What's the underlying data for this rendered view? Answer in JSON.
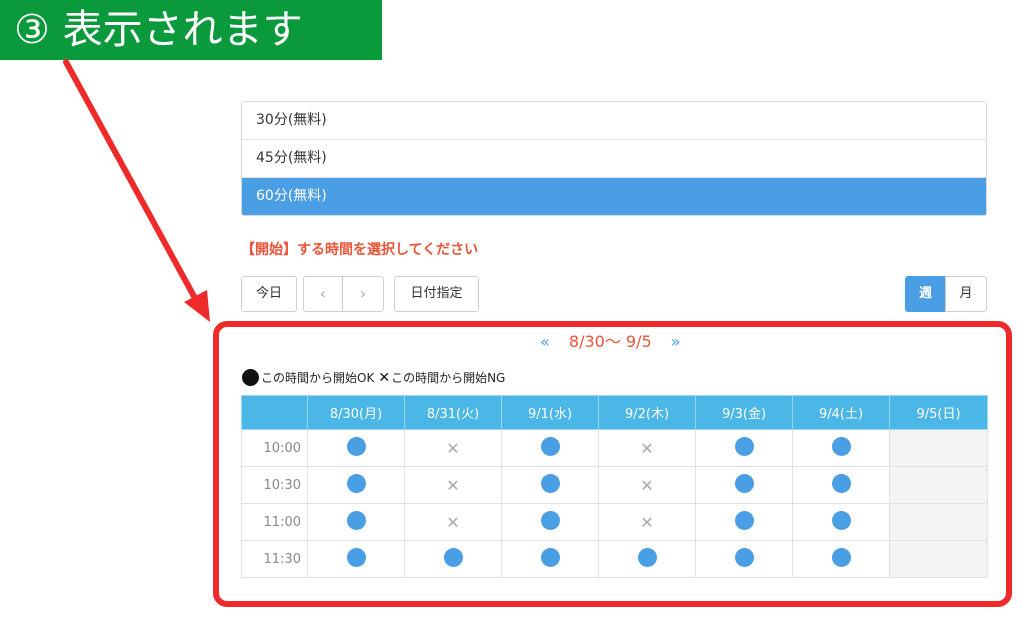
{
  "banner": {
    "text": "③ 表示されます",
    "color": "#0a9a3c"
  },
  "durations": [
    {
      "label": "30分(無料)",
      "selected": false
    },
    {
      "label": "45分(無料)",
      "selected": false
    },
    {
      "label": "60分(無料)",
      "selected": true
    }
  ],
  "instruction": "【開始】する時間を選択してください",
  "toolbar": {
    "today_label": "今日",
    "prev_icon": "chevron-left-icon",
    "next_icon": "chevron-right-icon",
    "date_label": "日付指定",
    "week_label": "週",
    "month_label": "月",
    "active_view": "週"
  },
  "range": {
    "prev_mark": "«",
    "text": "8/30〜 9/5",
    "next_mark": "»"
  },
  "legend": {
    "ok_text": "この時間から開始OK",
    "ng_text": "この時間から開始NG"
  },
  "schedule": {
    "columns": [
      "8/30(月)",
      "8/31(火)",
      "9/1(水)",
      "9/2(木)",
      "9/3(金)",
      "9/4(土)",
      "9/5(日)"
    ],
    "rows": [
      {
        "time": "10:00",
        "slots": [
          "ok",
          "ng",
          "ok",
          "ng",
          "ok",
          "ok",
          "closed"
        ]
      },
      {
        "time": "10:30",
        "slots": [
          "ok",
          "ng",
          "ok",
          "ng",
          "ok",
          "ok",
          "closed"
        ]
      },
      {
        "time": "11:00",
        "slots": [
          "ok",
          "ng",
          "ok",
          "ng",
          "ok",
          "ok",
          "closed"
        ]
      },
      {
        "time": "11:30",
        "slots": [
          "ok",
          "ok",
          "ok",
          "ok",
          "ok",
          "ok",
          "closed"
        ]
      }
    ]
  },
  "colors": {
    "accent": "#4a9ee3",
    "header": "#4bb7e6",
    "warning": "#e8553a",
    "highlight": "#ef2a2a"
  }
}
